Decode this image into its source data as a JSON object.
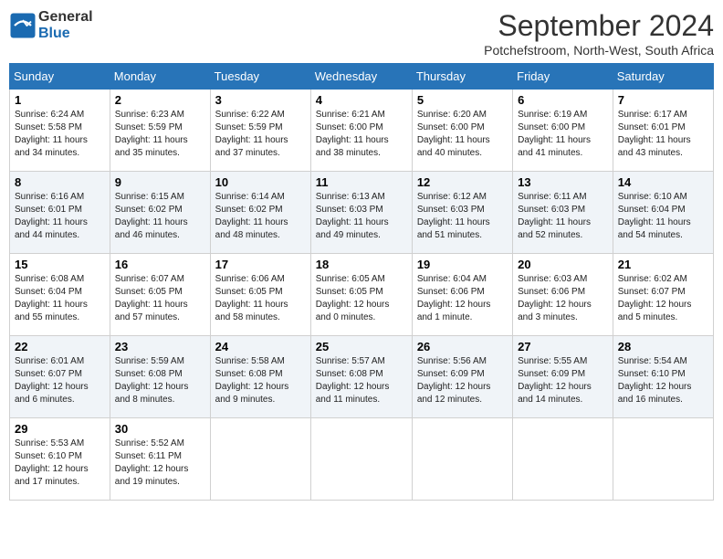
{
  "header": {
    "logo_general": "General",
    "logo_blue": "Blue",
    "month_title": "September 2024",
    "subtitle": "Potchefstroom, North-West, South Africa"
  },
  "days_of_week": [
    "Sunday",
    "Monday",
    "Tuesday",
    "Wednesday",
    "Thursday",
    "Friday",
    "Saturday"
  ],
  "weeks": [
    [
      {
        "day": "1",
        "info": "Sunrise: 6:24 AM\nSunset: 5:58 PM\nDaylight: 11 hours\nand 34 minutes."
      },
      {
        "day": "2",
        "info": "Sunrise: 6:23 AM\nSunset: 5:59 PM\nDaylight: 11 hours\nand 35 minutes."
      },
      {
        "day": "3",
        "info": "Sunrise: 6:22 AM\nSunset: 5:59 PM\nDaylight: 11 hours\nand 37 minutes."
      },
      {
        "day": "4",
        "info": "Sunrise: 6:21 AM\nSunset: 6:00 PM\nDaylight: 11 hours\nand 38 minutes."
      },
      {
        "day": "5",
        "info": "Sunrise: 6:20 AM\nSunset: 6:00 PM\nDaylight: 11 hours\nand 40 minutes."
      },
      {
        "day": "6",
        "info": "Sunrise: 6:19 AM\nSunset: 6:00 PM\nDaylight: 11 hours\nand 41 minutes."
      },
      {
        "day": "7",
        "info": "Sunrise: 6:17 AM\nSunset: 6:01 PM\nDaylight: 11 hours\nand 43 minutes."
      }
    ],
    [
      {
        "day": "8",
        "info": "Sunrise: 6:16 AM\nSunset: 6:01 PM\nDaylight: 11 hours\nand 44 minutes."
      },
      {
        "day": "9",
        "info": "Sunrise: 6:15 AM\nSunset: 6:02 PM\nDaylight: 11 hours\nand 46 minutes."
      },
      {
        "day": "10",
        "info": "Sunrise: 6:14 AM\nSunset: 6:02 PM\nDaylight: 11 hours\nand 48 minutes."
      },
      {
        "day": "11",
        "info": "Sunrise: 6:13 AM\nSunset: 6:03 PM\nDaylight: 11 hours\nand 49 minutes."
      },
      {
        "day": "12",
        "info": "Sunrise: 6:12 AM\nSunset: 6:03 PM\nDaylight: 11 hours\nand 51 minutes."
      },
      {
        "day": "13",
        "info": "Sunrise: 6:11 AM\nSunset: 6:03 PM\nDaylight: 11 hours\nand 52 minutes."
      },
      {
        "day": "14",
        "info": "Sunrise: 6:10 AM\nSunset: 6:04 PM\nDaylight: 11 hours\nand 54 minutes."
      }
    ],
    [
      {
        "day": "15",
        "info": "Sunrise: 6:08 AM\nSunset: 6:04 PM\nDaylight: 11 hours\nand 55 minutes."
      },
      {
        "day": "16",
        "info": "Sunrise: 6:07 AM\nSunset: 6:05 PM\nDaylight: 11 hours\nand 57 minutes."
      },
      {
        "day": "17",
        "info": "Sunrise: 6:06 AM\nSunset: 6:05 PM\nDaylight: 11 hours\nand 58 minutes."
      },
      {
        "day": "18",
        "info": "Sunrise: 6:05 AM\nSunset: 6:05 PM\nDaylight: 12 hours\nand 0 minutes."
      },
      {
        "day": "19",
        "info": "Sunrise: 6:04 AM\nSunset: 6:06 PM\nDaylight: 12 hours\nand 1 minute."
      },
      {
        "day": "20",
        "info": "Sunrise: 6:03 AM\nSunset: 6:06 PM\nDaylight: 12 hours\nand 3 minutes."
      },
      {
        "day": "21",
        "info": "Sunrise: 6:02 AM\nSunset: 6:07 PM\nDaylight: 12 hours\nand 5 minutes."
      }
    ],
    [
      {
        "day": "22",
        "info": "Sunrise: 6:01 AM\nSunset: 6:07 PM\nDaylight: 12 hours\nand 6 minutes."
      },
      {
        "day": "23",
        "info": "Sunrise: 5:59 AM\nSunset: 6:08 PM\nDaylight: 12 hours\nand 8 minutes."
      },
      {
        "day": "24",
        "info": "Sunrise: 5:58 AM\nSunset: 6:08 PM\nDaylight: 12 hours\nand 9 minutes."
      },
      {
        "day": "25",
        "info": "Sunrise: 5:57 AM\nSunset: 6:08 PM\nDaylight: 12 hours\nand 11 minutes."
      },
      {
        "day": "26",
        "info": "Sunrise: 5:56 AM\nSunset: 6:09 PM\nDaylight: 12 hours\nand 12 minutes."
      },
      {
        "day": "27",
        "info": "Sunrise: 5:55 AM\nSunset: 6:09 PM\nDaylight: 12 hours\nand 14 minutes."
      },
      {
        "day": "28",
        "info": "Sunrise: 5:54 AM\nSunset: 6:10 PM\nDaylight: 12 hours\nand 16 minutes."
      }
    ],
    [
      {
        "day": "29",
        "info": "Sunrise: 5:53 AM\nSunset: 6:10 PM\nDaylight: 12 hours\nand 17 minutes."
      },
      {
        "day": "30",
        "info": "Sunrise: 5:52 AM\nSunset: 6:11 PM\nDaylight: 12 hours\nand 19 minutes."
      },
      {
        "day": "",
        "info": ""
      },
      {
        "day": "",
        "info": ""
      },
      {
        "day": "",
        "info": ""
      },
      {
        "day": "",
        "info": ""
      },
      {
        "day": "",
        "info": ""
      }
    ]
  ]
}
